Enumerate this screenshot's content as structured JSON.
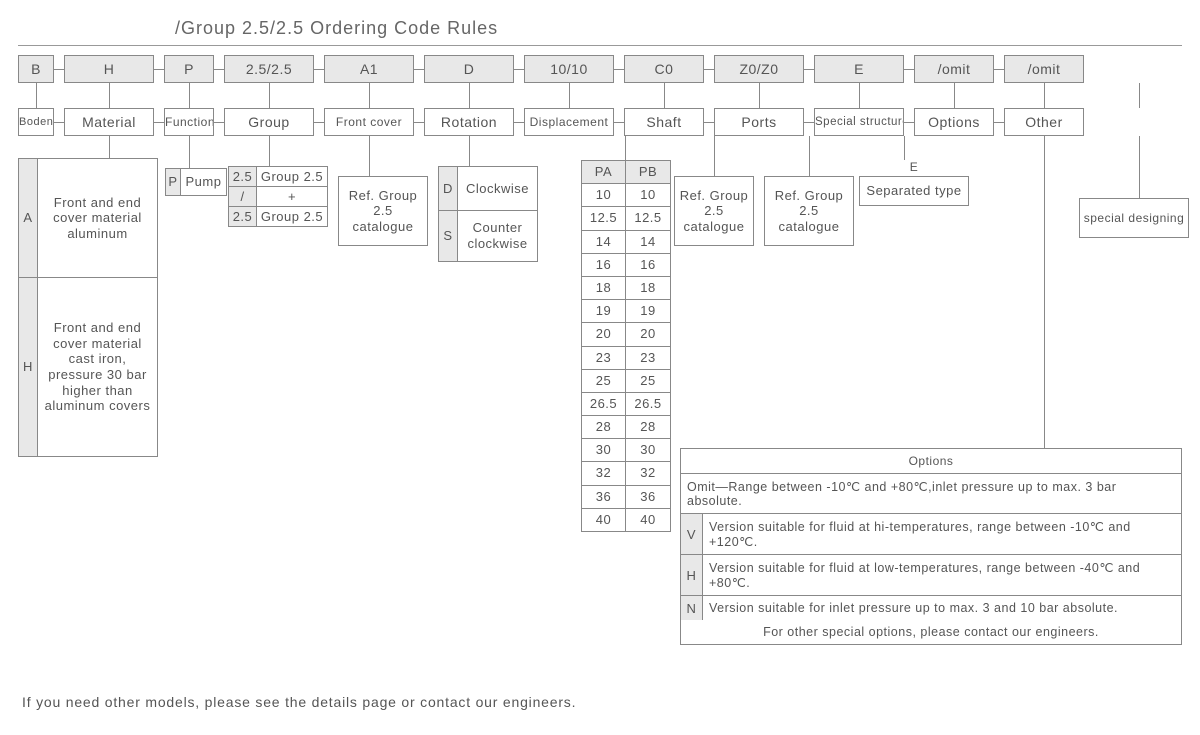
{
  "title": "/Group 2.5/2.5 Ordering Code Rules",
  "row1": [
    "B",
    "H",
    "P",
    "2.5/2.5",
    "A1",
    "D",
    "10/10",
    "C0",
    "Z0/Z0",
    "E",
    "/omit",
    "/omit"
  ],
  "row2": [
    "Boden",
    "Material",
    "Function",
    "Group",
    "Front cover",
    "Rotation",
    "Displacement",
    "Shaft",
    "Ports",
    "Special structure",
    "Options",
    "Other"
  ],
  "material": {
    "A": {
      "code": "A",
      "text": "Front and end cover material aluminum"
    },
    "H": {
      "code": "H",
      "text": "Front and end cover material cast iron, pressure 30 bar higher than aluminum covers"
    }
  },
  "function": {
    "code": "P",
    "text": "Pump"
  },
  "group": {
    "r1c1": "2.5",
    "r1c2": "Group 2.5",
    "r2c1": "/",
    "r2c2": "+",
    "r3c1": "2.5",
    "r3c2": "Group 2.5"
  },
  "front_cover": {
    "text": "Ref. Group 2.5 catalogue"
  },
  "rotation": {
    "D": {
      "code": "D",
      "text": "Clockwise"
    },
    "S": {
      "code": "S",
      "text": "Counter clockwise"
    }
  },
  "disp": {
    "hdr": [
      "PA",
      "PB"
    ],
    "rows": [
      [
        "10",
        "10"
      ],
      [
        "12.5",
        "12.5"
      ],
      [
        "14",
        "14"
      ],
      [
        "16",
        "16"
      ],
      [
        "18",
        "18"
      ],
      [
        "19",
        "19"
      ],
      [
        "20",
        "20"
      ],
      [
        "23",
        "23"
      ],
      [
        "25",
        "25"
      ],
      [
        "26.5",
        "26.5"
      ],
      [
        "28",
        "28"
      ],
      [
        "30",
        "30"
      ],
      [
        "32",
        "32"
      ],
      [
        "36",
        "36"
      ],
      [
        "40",
        "40"
      ]
    ]
  },
  "shaft": {
    "text": "Ref. Group 2.5 catalogue"
  },
  "ports": {
    "text": "Ref. Group 2.5 catalogue"
  },
  "special": {
    "code": "E",
    "text": "Separated type"
  },
  "other": {
    "text": "special designing"
  },
  "options_table": {
    "title": "Options",
    "rows": [
      {
        "code": "",
        "desc": "Omit—Range between -10℃ and +80℃,inlet pressure up to max. 3 bar absolute."
      },
      {
        "code": "V",
        "desc": "Version suitable for fluid at hi-temperatures, range between -10℃ and +120℃."
      },
      {
        "code": "H",
        "desc": "Version suitable for fluid at low-temperatures, range between -40℃ and +80℃."
      },
      {
        "code": "N",
        "desc": "Version suitable for inlet pressure up to max. 3 and 10 bar absolute."
      }
    ],
    "footer": "For other special options, please contact our engineers."
  },
  "footer": "If you need other models, please see the details page or contact our engineers."
}
